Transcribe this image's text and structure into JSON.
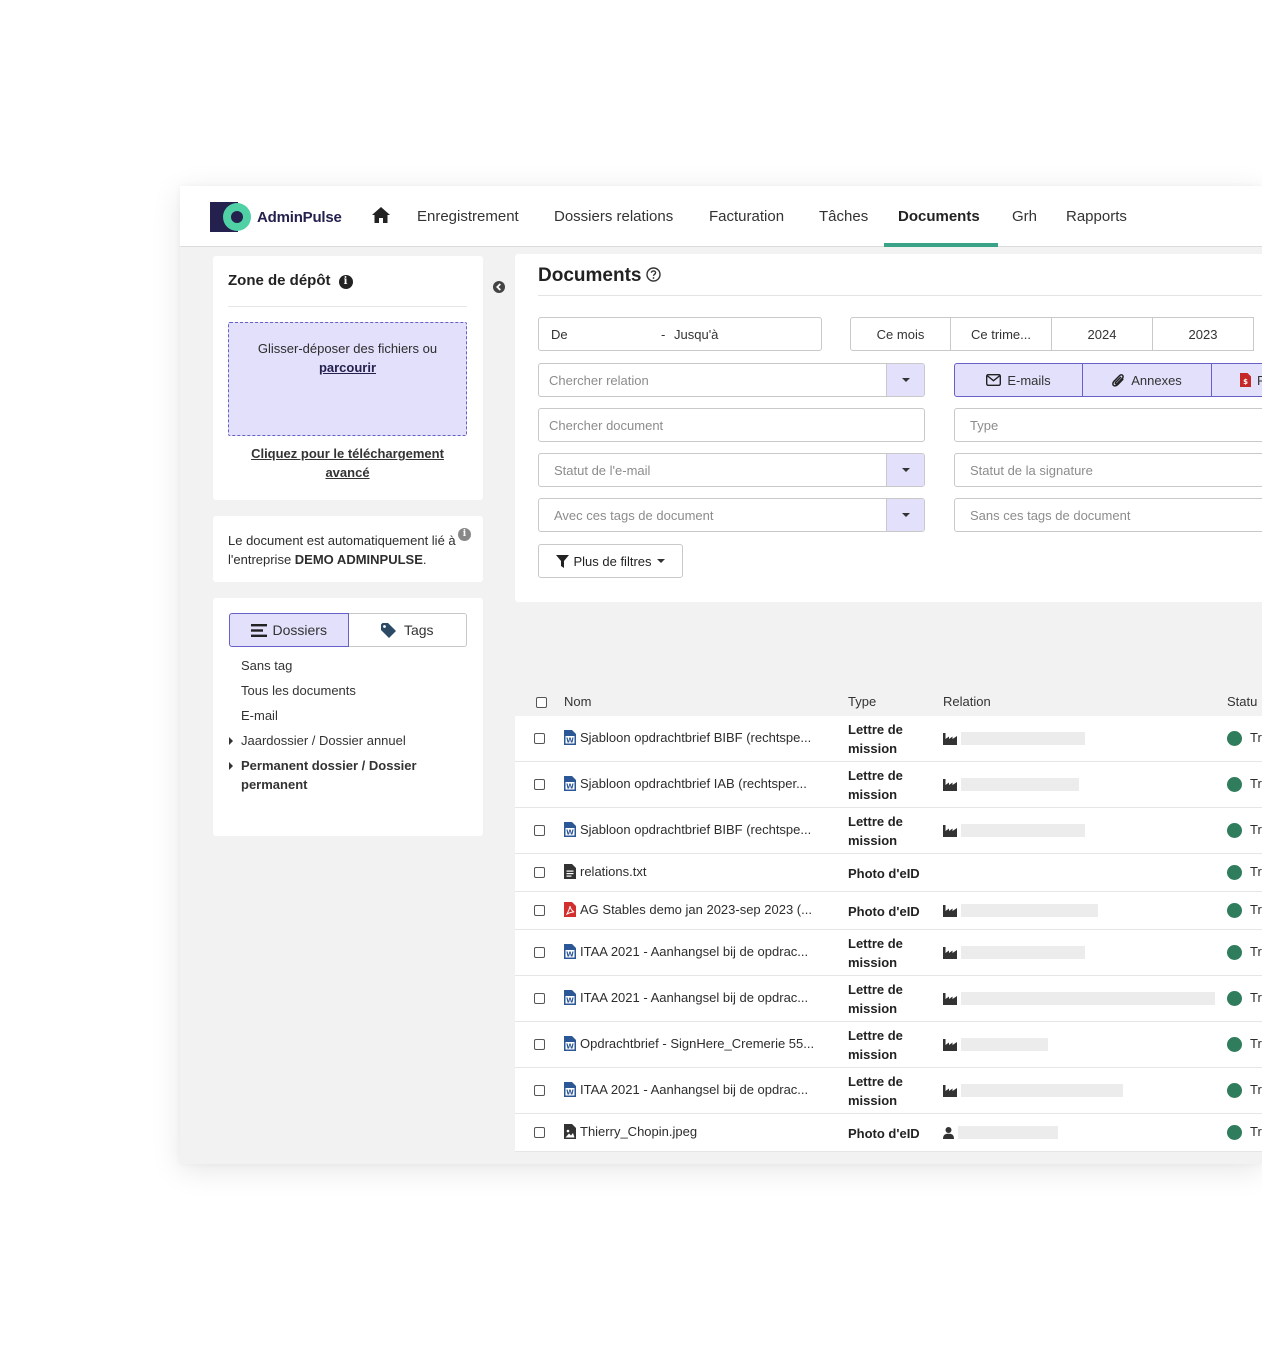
{
  "app": {
    "name": "AdminPulse"
  },
  "nav": {
    "items": [
      "Enregistrement",
      "Dossiers relations",
      "Facturation",
      "Tâches",
      "Documents",
      "Grh",
      "Rapports"
    ],
    "active": "Documents"
  },
  "dropzone": {
    "title": "Zone de dépôt",
    "hint": "Glisser-déposer des fichiers ou",
    "browse": "parcourir",
    "advanced_link": "Cliquez pour le téléchargement avancé"
  },
  "info": {
    "text_prefix": "Le document est automatiquement lié à l'entreprise ",
    "company": "DEMO ADMINPULSE",
    "text_suffix": "."
  },
  "folders": {
    "tabs": [
      "Dossiers",
      "Tags"
    ],
    "active_tab": "Dossiers",
    "items": [
      "Sans tag",
      "Tous les documents",
      "E-mail",
      "Jaardossier / Dossier annuel",
      "Permanent dossier / Dossier permanent"
    ]
  },
  "main": {
    "title": "Documents",
    "date_range": {
      "from": "De",
      "separator": "-",
      "to": "Jusqu'à"
    },
    "periods": [
      "Ce mois",
      "Ce trime...",
      "2024",
      "2023"
    ],
    "search_relation_placeholder": "Chercher relation",
    "search_document_placeholder": "Chercher document",
    "email_status_placeholder": "Statut de l'e-mail",
    "with_tags_placeholder": "Avec ces tags de document",
    "type_placeholder": "Type",
    "signature_status_placeholder": "Statut de la signature",
    "without_tags_placeholder": "Sans ces tags de document",
    "type_toggles": [
      "E-mails",
      "Annexes",
      "F"
    ],
    "more_filters": "Plus de filtres"
  },
  "table": {
    "headers": {
      "name": "Nom",
      "type": "Type",
      "relation": "Relation",
      "status": "Statu"
    },
    "rows": [
      {
        "name": "Sjabloon opdrachtbrief BIBF (rechtspe...",
        "file_icon": "word-icon",
        "type": "Lettre de mission",
        "relation_icon": "industry-icon",
        "status": "Tr"
      },
      {
        "name": "Sjabloon opdrachtbrief IAB (rechtsper...",
        "file_icon": "word-icon",
        "type": "Lettre de mission",
        "relation_icon": "industry-icon",
        "status": "Tr"
      },
      {
        "name": "Sjabloon opdrachtbrief BIBF (rechtspe...",
        "file_icon": "word-icon",
        "type": "Lettre de mission",
        "relation_icon": "industry-icon",
        "status": "Tr"
      },
      {
        "name": "relations.txt",
        "file_icon": "text-file-icon",
        "type": "Photo d'eID",
        "relation_icon": "",
        "status": "Tr"
      },
      {
        "name": "AG Stables demo jan 2023-sep 2023 (...",
        "file_icon": "pdf-icon",
        "type": "Photo d'eID",
        "relation_icon": "industry-icon",
        "status": "Tr"
      },
      {
        "name": "ITAA 2021 - Aanhangsel bij de opdrac...",
        "file_icon": "word-icon",
        "type": "Lettre de mission",
        "relation_icon": "industry-icon",
        "status": "Tr"
      },
      {
        "name": "ITAA 2021 - Aanhangsel bij de opdrac...",
        "file_icon": "word-icon",
        "type": "Lettre de mission",
        "relation_icon": "industry-icon",
        "status": "Tr"
      },
      {
        "name": "Opdrachtbrief - SignHere_Cremerie 55...",
        "file_icon": "word-icon",
        "type": "Lettre de mission",
        "relation_icon": "industry-icon",
        "status": "Tr"
      },
      {
        "name": "ITAA 2021 - Aanhangsel bij de opdrac...",
        "file_icon": "word-icon",
        "type": "Lettre de mission",
        "relation_icon": "industry-icon",
        "status": "Tr"
      },
      {
        "name": "Thierry_Chopin.jpeg",
        "file_icon": "image-file-icon",
        "type": "Photo d'eID",
        "relation_icon": "user-icon",
        "status": "Tr"
      }
    ]
  },
  "colors": {
    "brand_navy": "#24214f",
    "brand_green": "#4fd1a5",
    "accent_lavender": "#e2e0fb",
    "accent_border": "#6760c9",
    "status_green": "#2f7d5c",
    "nav_underline": "#3aa387"
  }
}
